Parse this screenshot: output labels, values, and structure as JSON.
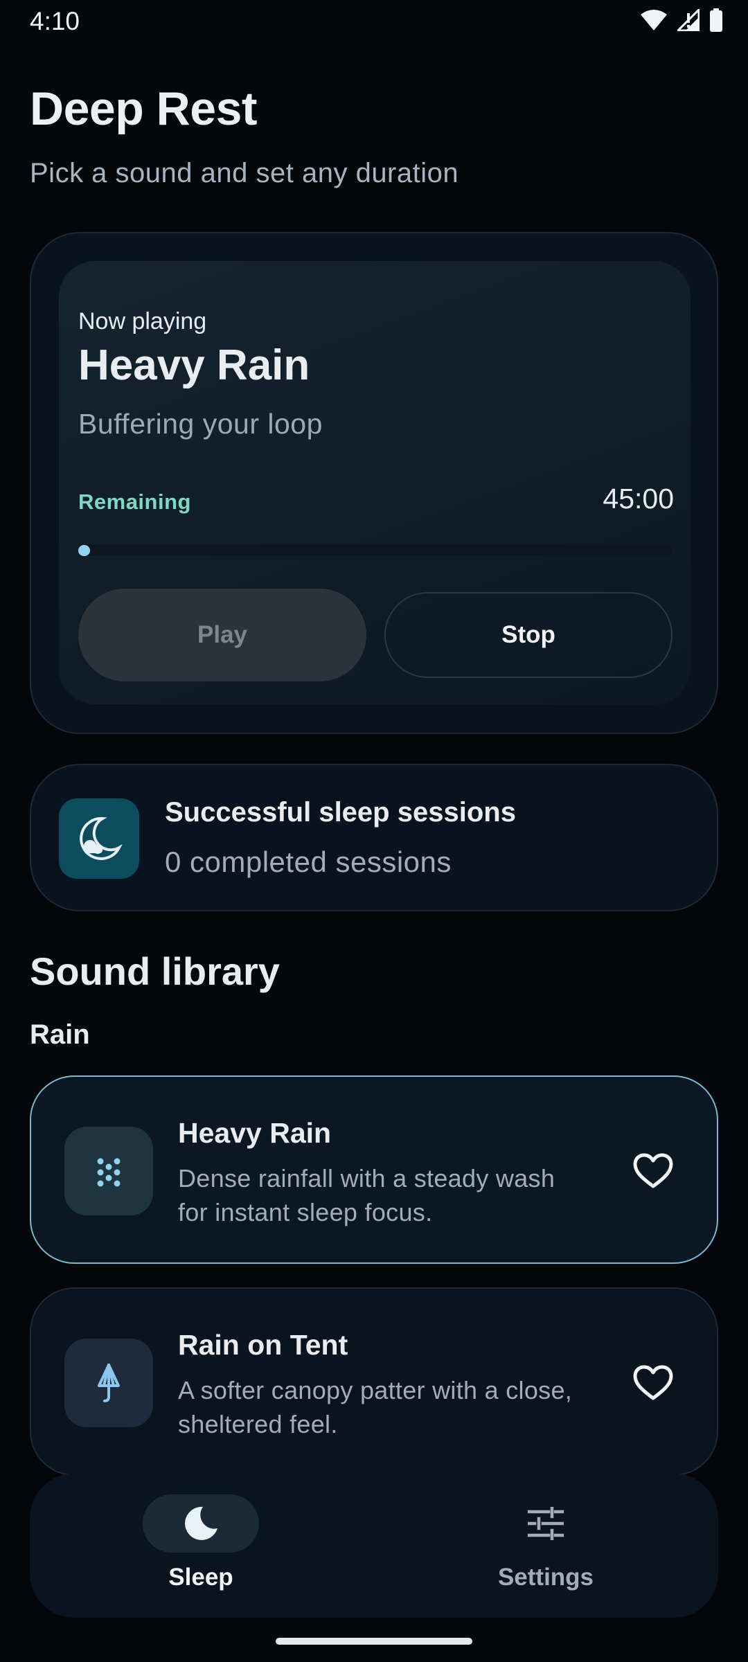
{
  "status_bar": {
    "time": "4:10",
    "icons": [
      "wifi-icon",
      "signal-icon",
      "battery-icon"
    ]
  },
  "header": {
    "title": "Deep Rest",
    "subtitle": "Pick a sound and set any duration"
  },
  "now_playing": {
    "label": "Now playing",
    "title": "Heavy Rain",
    "status": "Buffering your loop",
    "remaining_label": "Remaining",
    "remaining_time": "45:00",
    "progress_fraction": 0.02,
    "play_label": "Play",
    "stop_label": "Stop"
  },
  "sessions": {
    "icon": "moon-icon",
    "title": "Successful sleep sessions",
    "count_text": "0 completed sessions"
  },
  "library": {
    "title": "Sound library",
    "category": "Rain",
    "sounds": [
      {
        "name": "Heavy Rain",
        "description": "Dense rainfall with a steady wash for instant sleep focus.",
        "icon": "rain-drops-icon",
        "selected": true
      },
      {
        "name": "Rain on Tent",
        "description": "A softer canopy patter with a close, sheltered feel.",
        "icon": "umbrella-icon",
        "selected": false
      }
    ]
  },
  "bottom_nav": {
    "items": [
      {
        "label": "Sleep",
        "icon": "moon-icon",
        "active": true
      },
      {
        "label": "Settings",
        "icon": "sliders-icon",
        "active": false
      }
    ]
  },
  "colors": {
    "accent": "#8fd3ee",
    "remaining": "#7fd8c4",
    "background": "#04060a"
  }
}
